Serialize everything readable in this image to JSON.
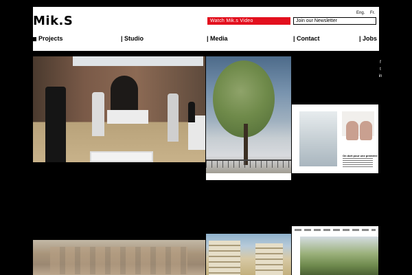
{
  "header": {
    "logo": "Mik.S",
    "languages": [
      "Eng.",
      "Fr."
    ],
    "video_button": "Watch Mik.s Video",
    "newsletter_placeholder": "Join our Newsletter"
  },
  "nav": {
    "items": [
      {
        "label": "Projects"
      },
      {
        "label": "| Studio"
      },
      {
        "label": "| Media"
      },
      {
        "label": "| Contact"
      },
      {
        "label": "| Jobs"
      }
    ]
  },
  "social": {
    "icons": [
      "facebook-icon",
      "twitter-icon",
      "linkedin-icon"
    ],
    "glyphs": [
      "f",
      "t",
      "in"
    ]
  },
  "tiles": {
    "magazine_caption": "On dort pour une première"
  },
  "colors": {
    "accent": "#e3101e",
    "background": "#000000",
    "header_background": "#ffffff"
  }
}
